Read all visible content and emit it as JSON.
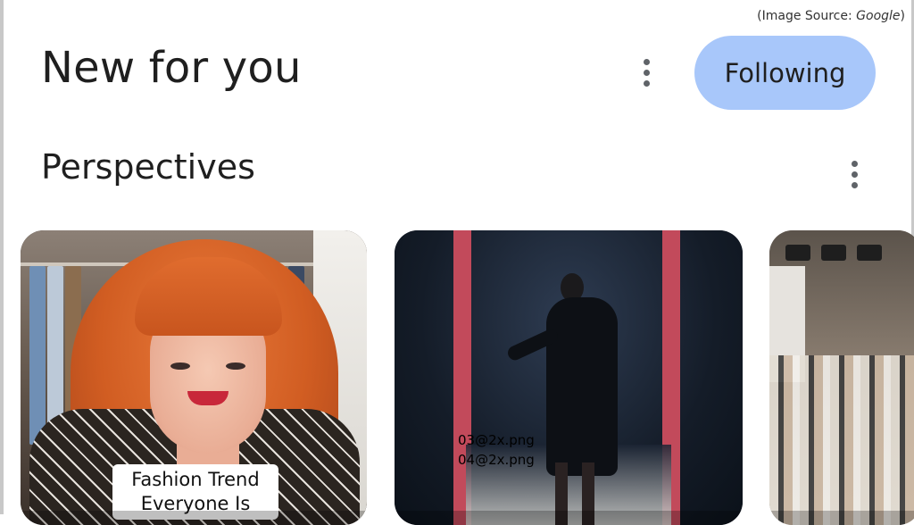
{
  "source": {
    "prefix": "(Image Source: ",
    "name": "Google",
    "suffix": ")"
  },
  "header": {
    "title": "New for you",
    "menu_icon": "more-vert-icon",
    "follow_label": "Following"
  },
  "section": {
    "title": "Perspectives",
    "menu_icon": "more-vert-icon"
  },
  "cards": [
    {
      "caption": "Fashion Trend Everyone Is"
    },
    {
      "overlay_lines": [
        "03@2x.png",
        "04@2x.png"
      ]
    },
    {}
  ],
  "colors": {
    "follow_button_bg": "#a8c7fa",
    "text": "#1f1f1f",
    "icon": "#5f6368"
  }
}
